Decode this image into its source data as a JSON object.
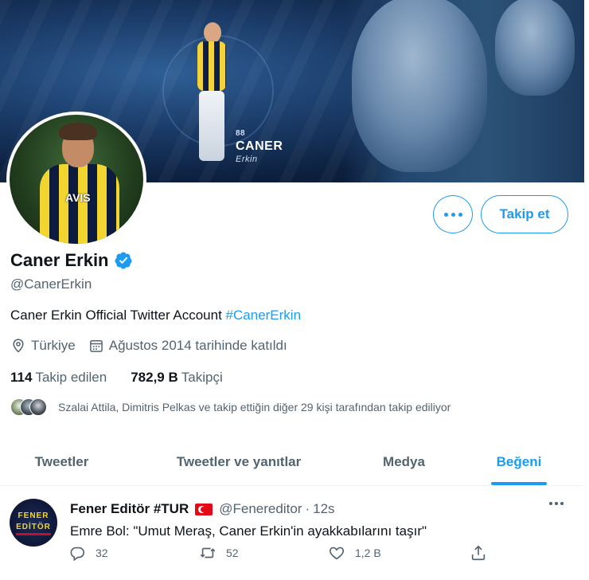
{
  "profile": {
    "banner_logo": {
      "number": "88",
      "name": "CANER",
      "signature": "Erkin"
    },
    "avatar_sponsor": "AVIS",
    "name": "Caner Erkin",
    "handle": "@CanerErkin",
    "bio_text": "Caner Erkin Official Twitter Account ",
    "bio_hashtag": "#CanerErkin",
    "location": "Türkiye",
    "joined": "Ağustos 2014 tarihinde katıldı",
    "following_count": "114",
    "following_label": "Takip edilen",
    "followers_count": "782,9 B",
    "followers_label": "Takipçi",
    "followed_by_text": "Szalai Attila, Dimitris Pelkas ve takip ettiğin diğer 29 kişi tarafından takip ediliyor"
  },
  "actions": {
    "follow_label": "Takip et",
    "more_icon": "more-horizontal-icon"
  },
  "tabs": [
    {
      "label": "Tweetler",
      "active": false
    },
    {
      "label": "Tweetler ve yanıtlar",
      "active": false
    },
    {
      "label": "Medya",
      "active": false
    },
    {
      "label": "Beğeni",
      "active": true
    }
  ],
  "tweet": {
    "avatar_text_line1": "FENER",
    "avatar_text_line2": "EDİTÖR",
    "author_name": "Fener Editör #TUR",
    "flag_icon": "turkey-flag-icon",
    "author_handle": "@Fenereditor",
    "separator": "·",
    "time": "12s",
    "text": "Emre Bol: \"Umut Meraş, Caner Erkin'in ayakkabılarını taşır\"",
    "reply_count": "32",
    "retweet_count": "52",
    "like_count": "1,2 B"
  },
  "colors": {
    "accent": "#1d9bf0",
    "text_primary": "#0f1419",
    "text_secondary": "#536471"
  }
}
